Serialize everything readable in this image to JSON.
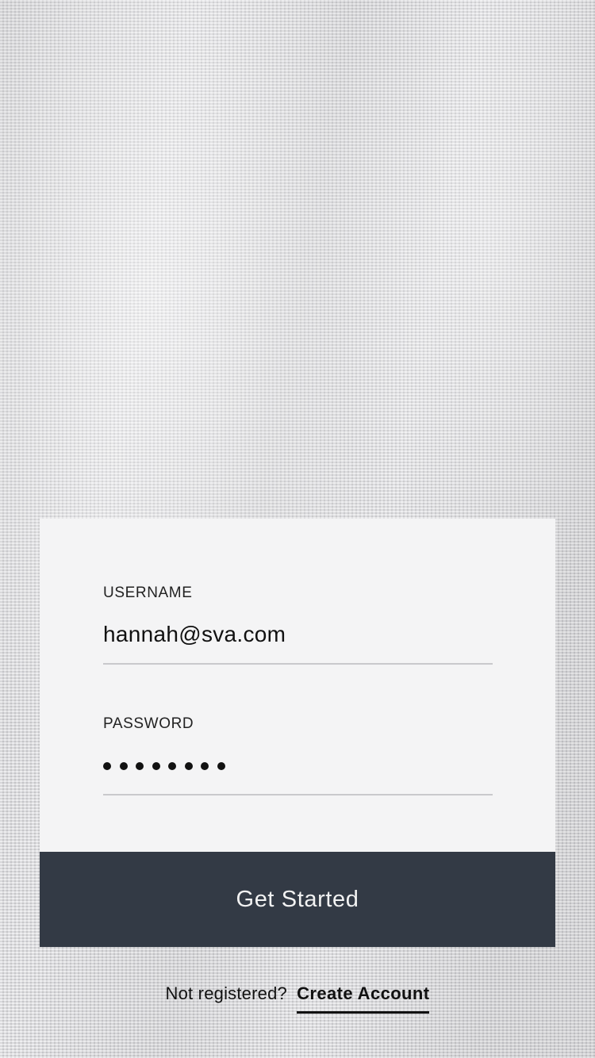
{
  "login": {
    "username_label": "USERNAME",
    "username_value": "hannah@sva.com",
    "password_label": "PASSWORD",
    "password_masked_length": 8,
    "submit_label": "Get Started"
  },
  "footer": {
    "prompt": "Not registered?",
    "link_label": "Create Account"
  },
  "colors": {
    "card_background": "#f4f4f5",
    "button_background": "#333a45",
    "button_text": "#f2f2f2",
    "input_underline": "#c9c9cc"
  }
}
